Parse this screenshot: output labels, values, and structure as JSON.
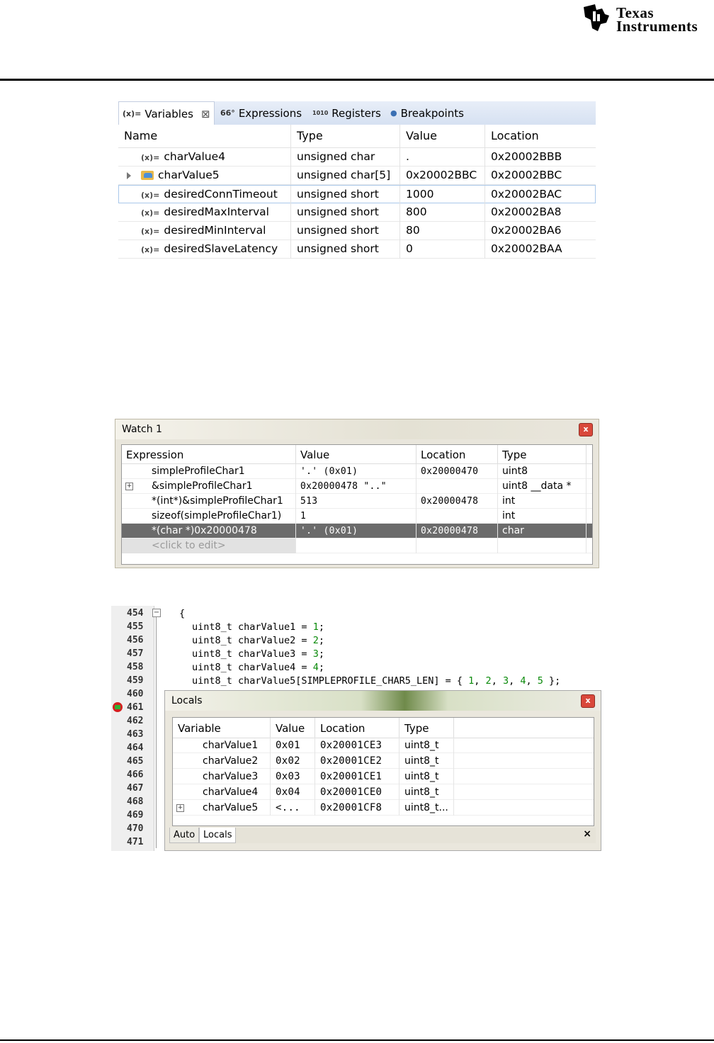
{
  "header": {
    "company_line1": "Texas",
    "company_line2": "Instruments"
  },
  "ccs_view": {
    "tabs": [
      {
        "icon": "(x)=",
        "label": "Variables"
      },
      {
        "icon": "66°",
        "label": "Expressions"
      },
      {
        "icon": "1010",
        "label": "Registers"
      },
      {
        "icon": "●",
        "label": "Breakpoints"
      }
    ],
    "columns": [
      "Name",
      "Type",
      "Value",
      "Location"
    ],
    "rows": [
      {
        "name": "charValue4",
        "type": "unsigned char",
        "value": ".",
        "location": "0x20002BBB"
      },
      {
        "name": "charValue5",
        "type": "unsigned char[5]",
        "value": "0x20002BBC",
        "location": "0x20002BBC"
      },
      {
        "name": "desiredConnTimeout",
        "type": "unsigned short",
        "value": "1000",
        "location": "0x20002BAC"
      },
      {
        "name": "desiredMaxInterval",
        "type": "unsigned short",
        "value": "800",
        "location": "0x20002BA8"
      },
      {
        "name": "desiredMinInterval",
        "type": "unsigned short",
        "value": "80",
        "location": "0x20002BA6"
      },
      {
        "name": "desiredSlaveLatency",
        "type": "unsigned short",
        "value": "0",
        "location": "0x20002BAA"
      }
    ]
  },
  "watch_window": {
    "title": "Watch 1",
    "close": "x",
    "columns": [
      "Expression",
      "Value",
      "Location",
      "Type"
    ],
    "rows": [
      {
        "expression": "simpleProfileChar1",
        "value": "'.' (0x01)",
        "location": "0x20000470",
        "type": "uint8"
      },
      {
        "expression": "&simpleProfileChar1",
        "value": "0x20000478 \"..\"",
        "location": "",
        "type": "uint8 __data *"
      },
      {
        "expression": "*(int*)&simpleProfileChar1",
        "value": "513",
        "location": "0x20000478",
        "type": "int"
      },
      {
        "expression": "sizeof(simpleProfileChar1)",
        "value": "1",
        "location": "",
        "type": "int"
      },
      {
        "expression": "*(char *)0x20000478",
        "value": "'.' (0x01)",
        "location": "0x20000478",
        "type": "char"
      },
      {
        "expression": "<click to edit>",
        "value": "",
        "location": "",
        "type": ""
      }
    ]
  },
  "editor": {
    "line_numbers": [
      "454",
      "455",
      "456",
      "457",
      "458",
      "459",
      "460",
      "461",
      "462",
      "463",
      "464",
      "465",
      "466",
      "467",
      "468",
      "469",
      "470",
      "471"
    ],
    "fold_symbol": "−",
    "code": {
      "brace": "{",
      "l455_a": "uint8_t charValue1 = ",
      "l455_n": "1",
      "l455_b": ";",
      "l456_a": "uint8_t charValue2 = ",
      "l456_n": "2",
      "l456_b": ";",
      "l457_a": "uint8_t charValue3 = ",
      "l457_n": "3",
      "l457_b": ";",
      "l458_a": "uint8_t charValue4 = ",
      "l458_n": "4",
      "l458_b": ";",
      "l459_a": "uint8_t charValue5[SIMPLEPROFILE_CHAR5_LEN] = { ",
      "l459_n1": "1",
      "l459_n2": "2",
      "l459_n3": "3",
      "l459_n4": "4",
      "l459_n5": "5",
      "sep": ", ",
      "l459_b": " };"
    }
  },
  "locals_window": {
    "title": "Locals",
    "close": "x",
    "columns": [
      "Variable",
      "Value",
      "Location",
      "Type"
    ],
    "rows": [
      {
        "variable": "charValue1",
        "value": "0x01",
        "location": "0x20001CE3",
        "type": "uint8_t"
      },
      {
        "variable": "charValue2",
        "value": "0x02",
        "location": "0x20001CE2",
        "type": "uint8_t"
      },
      {
        "variable": "charValue3",
        "value": "0x03",
        "location": "0x20001CE1",
        "type": "uint8_t"
      },
      {
        "variable": "charValue4",
        "value": "0x04",
        "location": "0x20001CE0",
        "type": "uint8_t"
      },
      {
        "variable": "charValue5",
        "value": "<...",
        "location": "0x20001CF8",
        "type": "uint8_t..."
      }
    ],
    "tabs": [
      "Auto",
      "Locals"
    ],
    "close_tab": "×"
  }
}
